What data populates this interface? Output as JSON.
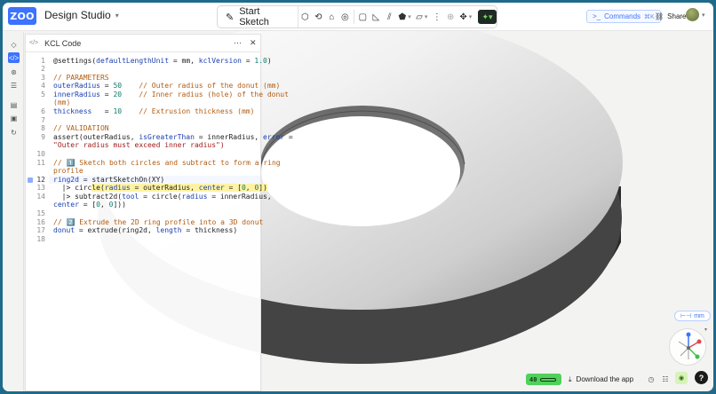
{
  "app": {
    "logo": "ZOO",
    "project_name": "Design Studio"
  },
  "toolbar": {
    "start_sketch": "Start Sketch",
    "tools": [
      "extrude-icon",
      "revolve-icon",
      "sweep-icon",
      "loft-icon",
      "fillet-icon",
      "chamfer-icon",
      "shell-icon",
      "boolean-icon",
      "plane-icon",
      "pattern-icon",
      "helix-icon",
      "move-icon",
      "ai-icon"
    ]
  },
  "header": {
    "commands_label": "Commands",
    "commands_shortcut": "⌘K",
    "share_label": "Share"
  },
  "code_panel": {
    "title": "KCL Code",
    "active_line": 12,
    "lines": [
      {
        "n": "1"
      },
      {
        "n": "2"
      },
      {
        "n": "3"
      },
      {
        "n": "4"
      },
      {
        "n": "5"
      },
      {
        "n": "6"
      },
      {
        "n": "7"
      },
      {
        "n": "8"
      },
      {
        "n": "9"
      },
      {
        "n": "10"
      },
      {
        "n": "11"
      },
      {
        "n": "12"
      },
      {
        "n": "13"
      },
      {
        "n": "14"
      },
      {
        "n": "15"
      },
      {
        "n": "16"
      },
      {
        "n": "17"
      },
      {
        "n": "18"
      }
    ],
    "code": {
      "l1_a": "@settings(",
      "l1_b": "defaultLengthUnit",
      "l1_c": " = mm, ",
      "l1_d": "kclVersion",
      "l1_e": " = ",
      "l1_f": "1.0",
      "l1_g": ")",
      "l3": "// PARAMETERS",
      "l4_a": "outerRadius",
      "l4_b": " = ",
      "l4_c": "50",
      "l4_d": "    // Outer radius of the donut (mm)",
      "l5_a": "innerRadius",
      "l5_b": " = ",
      "l5_c": "20",
      "l5_d": "    // Inner radius (hole) of the donut",
      "l5_wrap": "(mm)",
      "l6_a": "thickness",
      "l6_b": "   = ",
      "l6_c": "10",
      "l6_d": "    // Extrusion thickness (mm)",
      "l8": "// VALIDATION",
      "l9_a": "assert(outerRadius, ",
      "l9_b": "isGreaterThan",
      "l9_c": " = innerRadius, ",
      "l9_d": "error",
      "l9_e": " =",
      "l9_wrap": "\"Outer radius must exceed inner radius\")",
      "l11_a": "// ",
      "l11_b": "1️⃣",
      "l11_c": " Sketch both circles and subtract to form a ring",
      "l11_wrap": "profile",
      "l12_a": "ring2d",
      "l12_b": " = startSketchOn(XY)",
      "l13_a": "  |> circ",
      "l13_b": "le(",
      "l13_c": "radius",
      "l13_d": " = ",
      "l13_e": "outerRadius",
      "l13_f": ", ",
      "l13_g": "center",
      "l13_h": " = [",
      "l13_i": "0",
      "l13_j": ", ",
      "l13_k": "0",
      "l13_l": "])",
      "l14_a": "  |> subtract2d(",
      "l14_b": "tool",
      "l14_c": " = circle(",
      "l14_d": "radius",
      "l14_e": " = innerRadius,",
      "l14_wrap_a": "center",
      "l14_wrap_b": " = [",
      "l14_wrap_c": "0",
      "l14_wrap_d": ", ",
      "l14_wrap_e": "0",
      "l14_wrap_f": "]))",
      "l16_a": "// ",
      "l16_b": "2️⃣",
      "l16_c": " Extrude the 2D ring profile into a 3D donut",
      "l17_a": "donut",
      "l17_b": " = extrude(ring2d, ",
      "l17_c": "length",
      "l17_d": " = thickness)"
    }
  },
  "viewport": {
    "unit_label": "mm"
  },
  "status_bar": {
    "fps": "40",
    "download_label": "Download the app"
  },
  "colors": {
    "accent": "#3c73ff",
    "fps_green": "#4fd15a",
    "comment": "#b15c12",
    "keyword": "#1a3fb0",
    "number": "#0f7b6c"
  }
}
